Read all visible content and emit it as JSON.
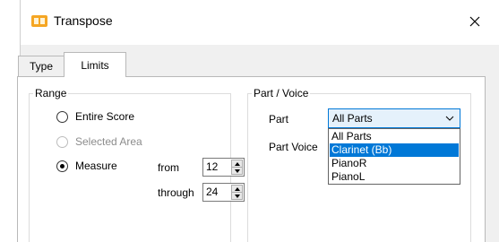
{
  "window": {
    "title": "Transpose"
  },
  "tabs": [
    {
      "label": "Type"
    },
    {
      "label": "Limits"
    }
  ],
  "range": {
    "title": "Range",
    "options": [
      {
        "label": "Entire Score",
        "selected": false,
        "enabled": true
      },
      {
        "label": "Selected Area",
        "selected": false,
        "enabled": false
      },
      {
        "label": "Measure",
        "selected": true,
        "enabled": true
      }
    ],
    "from_label": "from",
    "from_value": "12",
    "through_label": "through",
    "through_value": "24"
  },
  "part_voice": {
    "title": "Part / Voice",
    "part_label": "Part",
    "part_value": "All Parts",
    "voice_label": "Part Voice",
    "options": [
      "All Parts",
      "Clarinet (Bb)",
      "PianoR",
      "PianoL"
    ],
    "highlighted": "Clarinet (Bb)"
  },
  "icons": {
    "app": "transpose-app-icon",
    "close": "close-icon",
    "combo": "chevron-down-icon",
    "spin_up": "arrow-up-icon",
    "spin_down": "arrow-down-icon"
  },
  "colors": {
    "accent": "#0078d7",
    "combo_bg": "#e5f1fb",
    "app_icon": "#f5a623"
  }
}
